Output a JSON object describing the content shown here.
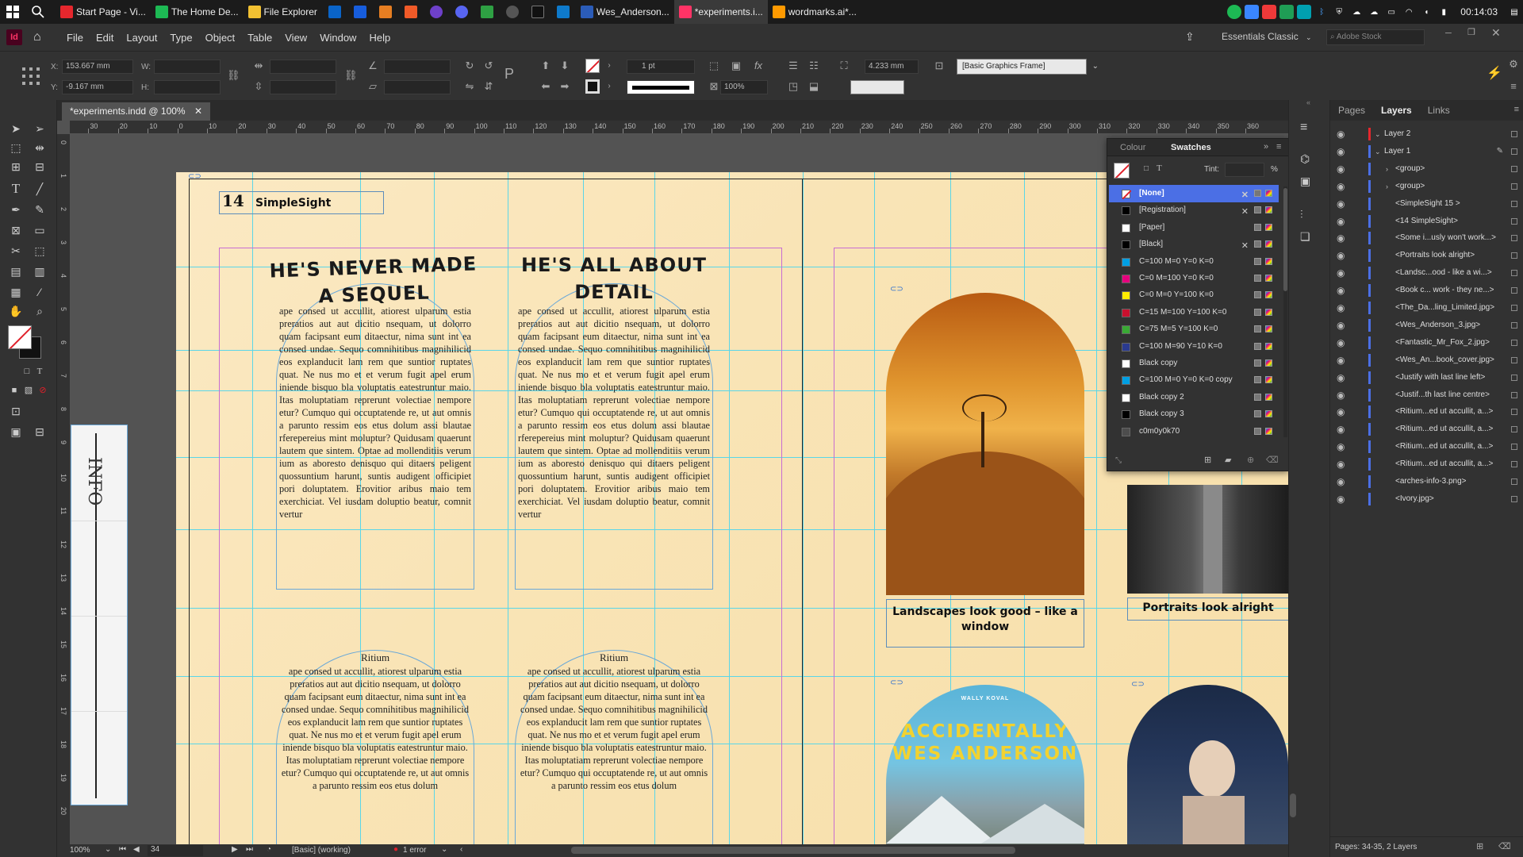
{
  "taskbar": {
    "apps": [
      {
        "label": "Start Page - Vi...",
        "color": "#e5272d"
      },
      {
        "label": "The Home De...",
        "color": "#1db954"
      },
      {
        "label": "File Explorer",
        "color": "#f2c132"
      },
      {
        "label": "Wes_Anderson...",
        "color": "#2b5cb8"
      },
      {
        "label": "*experiments.i...",
        "color": "#ff3366",
        "active": true
      },
      {
        "label": "wordmarks.ai*...",
        "color": "#ff9a00"
      }
    ],
    "time": "00:14:03",
    "time_secondary": "",
    "tray_icons": [
      "spotify-icon",
      "store-icon",
      "vivaldi-icon",
      "folder-icon",
      "wifi-icon",
      "bluetooth-icon",
      "shield-icon",
      "onedrive-icon",
      "cloud-icon",
      "printer-icon",
      "speaker-icon",
      "battery-icon"
    ]
  },
  "menubar": {
    "app_badge": "Id",
    "items": [
      "File",
      "Edit",
      "Layout",
      "Type",
      "Object",
      "Table",
      "View",
      "Window",
      "Help"
    ],
    "workspace": "Essentials Classic",
    "search_placeholder": "Adobe Stock"
  },
  "controlbar": {
    "x_label": "X:",
    "x_value": "153.667 mm",
    "y_label": "Y:",
    "y_value": "-9.167 mm",
    "w_label": "W:",
    "h_label": "H:",
    "stroke_weight": "1 pt",
    "zoom_value": "100%",
    "ref_size": "4.233 mm",
    "object_style": "[Basic Graphics Frame]"
  },
  "document": {
    "tab_title": "*experiments.indd @ 100%",
    "hruler_ticks": [
      "40",
      "30",
      "20",
      "10",
      "0",
      "10",
      "20",
      "30",
      "40",
      "50",
      "60",
      "70",
      "80",
      "90",
      "100",
      "110",
      "120",
      "130",
      "140",
      "150",
      "160",
      "170",
      "180",
      "190",
      "200",
      "210",
      "220",
      "230",
      "240",
      "250",
      "260",
      "270",
      "280",
      "290",
      "300",
      "310",
      "320",
      "330",
      "340",
      "350",
      "360"
    ],
    "vruler_ticks": [
      "0",
      "1",
      "2",
      "3",
      "4",
      "5",
      "6",
      "7",
      "8",
      "9",
      "10",
      "11",
      "12",
      "13",
      "14",
      "15",
      "16",
      "17",
      "18",
      "19",
      "20"
    ]
  },
  "spread": {
    "folio_number": "14",
    "folio_title": "SimpleSight",
    "headline_left": "HE'S NEVER MADE A SEQUEL",
    "headline_right": "HE'S ALL ABOUT DETAIL",
    "body_text_a": "ape consed ut accullit, atiorest ulparum estia preratios aut aut dicitio nsequam, ut dolorro quam facipsant eum ditaectur, nima sunt int ea consed undae. Sequo comnihitibus magnihilicid eos explanducit lam rem que suntior ruptates quat. Ne nus mo et et verum fugit apel erum iniende bisquo bla voluptatis eatestruntur maio. Itas moluptatiam reprerunt volectiae nempore etur? Cumquo qui occuptatende re, ut aut omnis a parunto ressim eos etus dolum assi blautae rferepereius mint moluptur? Quidusam quaerunt lautem que sintem. Optae ad mollenditiis verum ium as aboresto denisquo qui ditaers peligent quossuntium harunt, suntis audigent officipiet pori doluptatem. Erovitior aribus maio tem exerchiciat. Vel iusdam doluptio beatur, comnit vertur",
    "body_text_b": "ape consed ut accullit, atiorest ulparum estia preratios aut aut dicitio nsequam, ut dolorro quam facipsant eum ditaectur, nima sunt int ea consed undae. Sequo comnihitibus magnihilicid eos explanducit lam rem que suntior ruptates quat. Ne nus mo et et verum fugit apel erum iniende bisquo bla voluptatis eatestruntur maio. Itas moluptatiam reprerunt volectiae nempore etur? Cumquo qui occuptatende re, ut aut omnis a parunto ressim eos etus dolum",
    "ritium_label": "Ritium",
    "caption_landscape": "Landscapes look good – like a window",
    "caption_portrait": "Portraits look alright",
    "book_author": "WALLY KOVAL",
    "book_title_line1": "ACCIDENTALLY",
    "book_title_line2": "WES ANDERSON",
    "info_scribble": "INFO"
  },
  "swatches_panel": {
    "tabs": [
      "Colour",
      "Swatches"
    ],
    "tint_label": "Tint:",
    "tint_unit": "%",
    "items": [
      {
        "name": "[None]",
        "color": "none",
        "selected": true
      },
      {
        "name": "[Registration]",
        "color": "#000000"
      },
      {
        "name": "[Paper]",
        "color": "#ffffff"
      },
      {
        "name": "[Black]",
        "color": "#000000"
      },
      {
        "name": "C=100 M=0 Y=0 K=0",
        "color": "#009fe3"
      },
      {
        "name": "C=0 M=100 Y=0 K=0",
        "color": "#e6007e"
      },
      {
        "name": "C=0 M=0 Y=100 K=0",
        "color": "#ffed00"
      },
      {
        "name": "C=15 M=100 Y=100 K=0",
        "color": "#c8102e"
      },
      {
        "name": "C=75 M=5 Y=100 K=0",
        "color": "#3aaa35"
      },
      {
        "name": "C=100 M=90 Y=10 K=0",
        "color": "#2a3a8f"
      },
      {
        "name": "Black copy",
        "color": "#ffffff"
      },
      {
        "name": "C=100 M=0 Y=0 K=0 copy",
        "color": "#009fe3"
      },
      {
        "name": "Black copy 2",
        "color": "#ffffff"
      },
      {
        "name": "Black copy 3",
        "color": "#000000"
      },
      {
        "name": "c0m0y0k70",
        "color": "#4d4d4d"
      }
    ]
  },
  "layers_panel": {
    "tabs": [
      "Pages",
      "Layers",
      "Links"
    ],
    "rows": [
      {
        "label": "Layer 2",
        "depth": 0,
        "bar": "#e5272d"
      },
      {
        "label": "Layer 1",
        "depth": 0,
        "bar": "#4b6fe5"
      },
      {
        "label": "<group>",
        "depth": 1
      },
      {
        "label": "<group>",
        "depth": 1
      },
      {
        "label": "<SimpleSight 15 >",
        "depth": 1
      },
      {
        "label": "<14 SimpleSight>",
        "depth": 1
      },
      {
        "label": "<Some i...usly won't work...>",
        "depth": 1
      },
      {
        "label": "<Portraits look alright>",
        "depth": 1
      },
      {
        "label": "<Landsc...ood - like a wi...>",
        "depth": 1
      },
      {
        "label": "<Book c... work - they ne...>",
        "depth": 1
      },
      {
        "label": "<The_Da...ling_Limited.jpg>",
        "depth": 1
      },
      {
        "label": "<Wes_Anderson_3.jpg>",
        "depth": 1
      },
      {
        "label": "<Fantastic_Mr_Fox_2.jpg>",
        "depth": 1
      },
      {
        "label": "<Wes_An...book_cover.jpg>",
        "depth": 1
      },
      {
        "label": "<Justify with last line left>",
        "depth": 1
      },
      {
        "label": "<Justif...th last line centre>",
        "depth": 1
      },
      {
        "label": "<Ritium...ed ut accullit, a...>",
        "depth": 1
      },
      {
        "label": "<Ritium...ed ut accullit, a...>",
        "depth": 1
      },
      {
        "label": "<Ritium...ed ut accullit, a...>",
        "depth": 1
      },
      {
        "label": "<Ritium...ed ut accullit, a...>",
        "depth": 1
      },
      {
        "label": "<arches-info-3.png>",
        "depth": 1
      },
      {
        "label": "<Ivory.jpg>",
        "depth": 1
      }
    ],
    "footer": "Pages: 34-35, 2 Layers"
  },
  "statusbar": {
    "zoom": "100%",
    "page": "34",
    "preflight_profile": "[Basic] (working)",
    "errors": "1 error"
  }
}
